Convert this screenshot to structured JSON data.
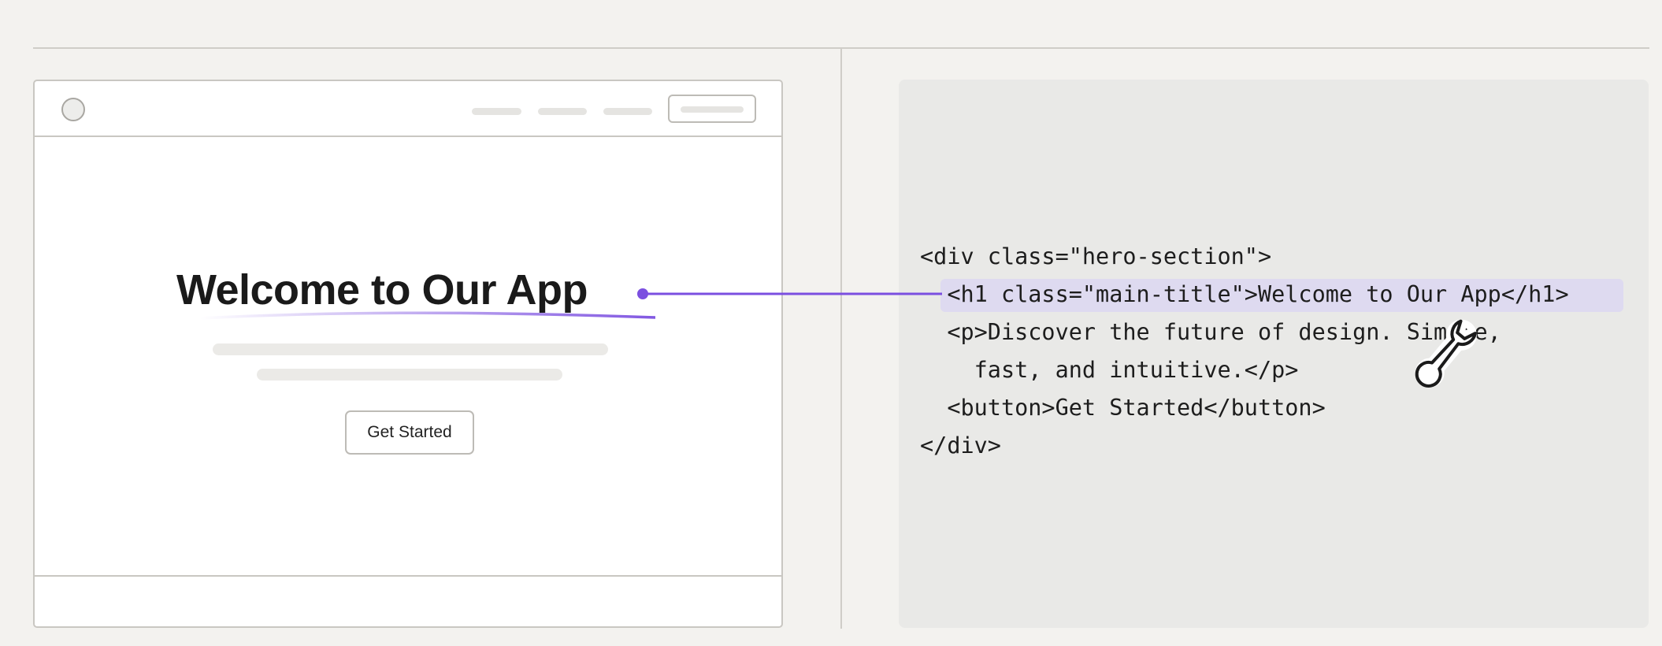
{
  "preview": {
    "hero_title": "Welcome to Our App",
    "cta_label": "Get Started"
  },
  "code": {
    "lines": [
      "<div class=\"hero-section\">",
      "  <h1 class=\"main-title\">Welcome to Our App</h1>",
      "  <p>Discover the future of design. Simple,",
      "    fast, and intuitive.</p>",
      "  <button>Get Started</button>",
      "</div>"
    ],
    "highlighted_line": 1
  },
  "icons": {
    "connector": "link-line-icon",
    "cursor": "wrench-icon"
  },
  "colors": {
    "accent": "#7b4fe0",
    "highlight": "#dedaf0",
    "background": "#f3f2ef"
  }
}
